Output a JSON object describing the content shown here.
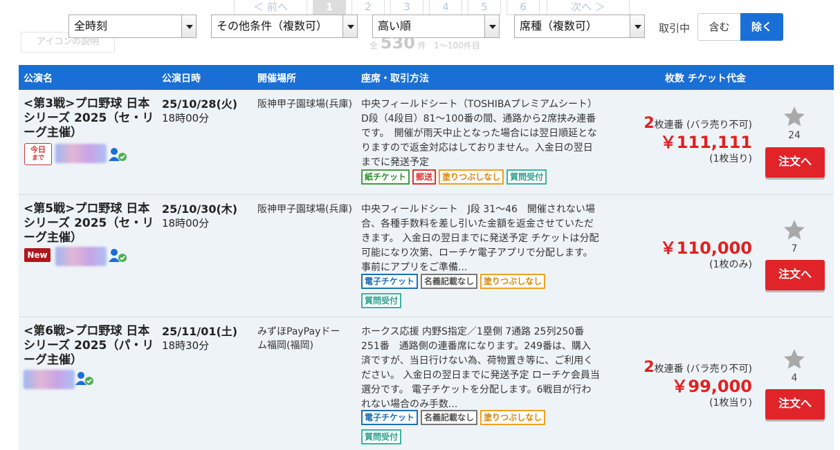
{
  "pager": {
    "prev": "＜ 前へ",
    "pages": [
      "1",
      "2",
      "3",
      "4",
      "5",
      "6"
    ],
    "next": "次へ ＞",
    "icon_desc": "アイコンの説明",
    "total_prefix": "全",
    "total": "530",
    "total_unit": "件",
    "range": "1〜100件目"
  },
  "filters": {
    "time": "全時刻",
    "conditions": "その他条件（複数可）",
    "sort": "高い順",
    "seat_type": "席種（複数可）",
    "trading_label": "取引中",
    "include": "含む",
    "exclude": "除く"
  },
  "table": {
    "headers": {
      "name": "公演名",
      "datetime": "公演日時",
      "venue": "開催場所",
      "seat": "座席・取引方法",
      "price": "枚数 チケット代金"
    },
    "rows": [
      {
        "title": "<第3戦>プロ野球 日本シリーズ 2025（セ・リーグ主催）",
        "badge": "今日",
        "badge_sub": "まで",
        "date": "25/10/28(火)",
        "time": "18時00分",
        "venue": "阪神甲子園球場(兵庫)",
        "desc": "中央フィールドシート（TOSHIBAプレミアムシート）D段（4段目）81〜100番の間、通路から2席挟み連番です。　開催が雨天中止となった場合には翌日順延となりますので返金対応はしておりません。入金日の翌日までに発送予定",
        "tags": [
          {
            "label": "紙チケット",
            "color": "green"
          },
          {
            "label": "郵送",
            "color": "red"
          },
          {
            "label": "塗りつぶしなし",
            "color": "orange"
          },
          {
            "label": "質問受付",
            "color": "teal"
          }
        ],
        "qty_num": "2",
        "qty_text": "枚連番 (バラ売り不可)",
        "price": "￥111,111",
        "per": "(1枚当り)",
        "favorites": "24",
        "order": "注文へ"
      },
      {
        "title": "<第5戦>プロ野球 日本シリーズ 2025（セ・リーグ主催）",
        "badge": "New",
        "date": "25/10/30(木)",
        "time": "18時00分",
        "venue": "阪神甲子園球場(兵庫)",
        "desc": "中央フィールドシート　J段 31〜46　開催されない場合、各種手数料を差し引いた金額を返金させていただきます。 入金日の翌日までに発送予定 チケットは分配可能になり次第、ローチケ電子アプリで分配します。事前にアプリをご準備...",
        "tags": [
          {
            "label": "電子チケット",
            "color": "blue"
          },
          {
            "label": "名義記載なし",
            "color": "gray"
          },
          {
            "label": "塗りつぶしなし",
            "color": "orange"
          },
          {
            "label": "質問受付",
            "color": "teal"
          }
        ],
        "price": "￥110,000",
        "per": "(1枚のみ)",
        "favorites": "7",
        "order": "注文へ"
      },
      {
        "title": "<第6戦>プロ野球 日本シリーズ 2025（パ・リーグ主催）",
        "date": "25/11/01(土)",
        "time": "18時30分",
        "venue": "みずほPayPayドーム福岡(福岡)",
        "desc": "ホークス応援 内野S指定／1塁側 7通路 25列250番 251番　通路側の連番席になります。249番は、購入済ですが、当日行けない為、荷物置き等に、ご利用ください。 入金日の翌日までに発送予定 ローチケ会員当選分です。 電子チケットを分配します。6戦目が行われない場合のみ手数...",
        "tags": [
          {
            "label": "電子チケット",
            "color": "blue"
          },
          {
            "label": "名義記載なし",
            "color": "gray"
          },
          {
            "label": "塗りつぶしなし",
            "color": "orange"
          },
          {
            "label": "質問受付",
            "color": "teal"
          }
        ],
        "qty_num": "2",
        "qty_text": "枚連番 (バラ売り不可)",
        "price": "￥99,000",
        "per": "(1枚当り)",
        "favorites": "4",
        "order": "注文へ"
      }
    ]
  },
  "colors": {
    "header_bg": "#1a6fd6",
    "row_bg": "#eef3f7",
    "price_red": "#e02020",
    "order_red": "#e0242a"
  },
  "icons": [
    "star-icon",
    "user-verified-icon",
    "dropdown-arrow-icon"
  ]
}
